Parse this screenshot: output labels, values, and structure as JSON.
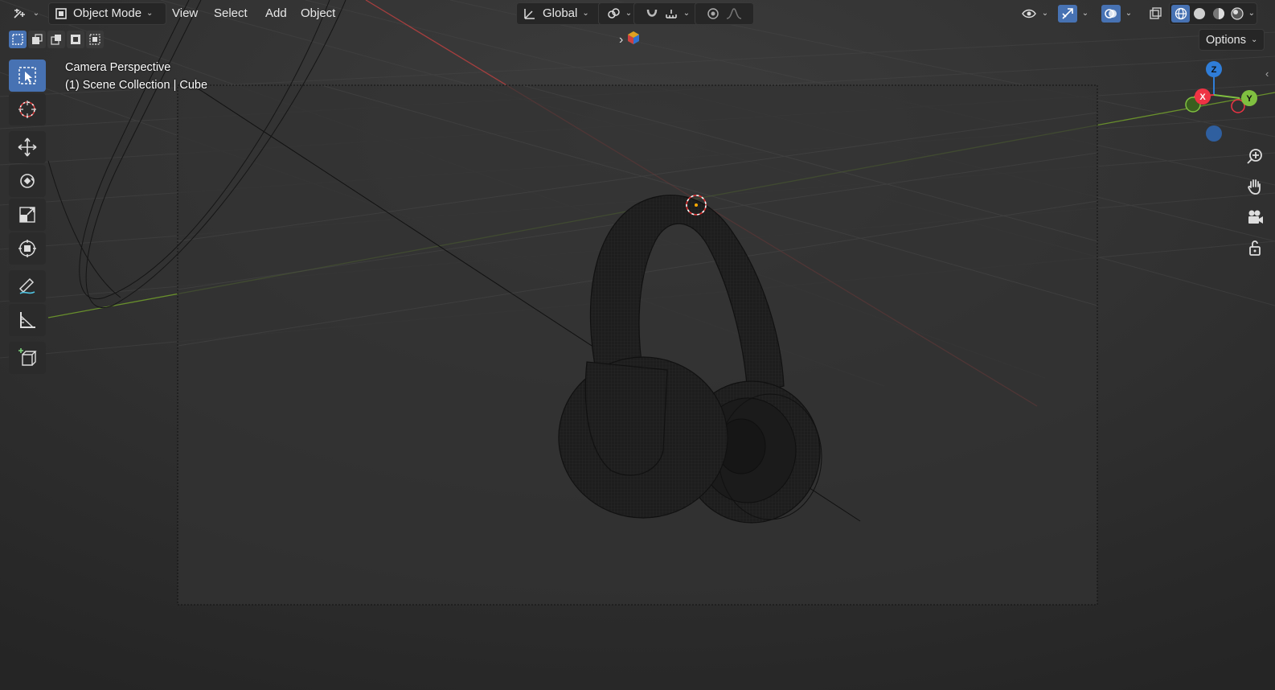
{
  "header": {
    "mode_label": "Object Mode",
    "menus": [
      "View",
      "Select",
      "Add",
      "Object"
    ],
    "transform_orientation": "Global"
  },
  "overlay": {
    "view_name": "Camera Perspective",
    "collection": "(1) Scene Collection | Cube"
  },
  "options_label": "Options",
  "gizmo": {
    "x": "X",
    "y": "Y",
    "z": "Z"
  },
  "tools": [
    "select-box",
    "cursor",
    "move",
    "rotate",
    "scale",
    "transform",
    "annotate",
    "measure",
    "add-cube"
  ],
  "colors": {
    "accent": "#4772b3",
    "x_axis": "#ee3344",
    "y_axis": "#80c040",
    "z_axis": "#2f7dd8"
  }
}
